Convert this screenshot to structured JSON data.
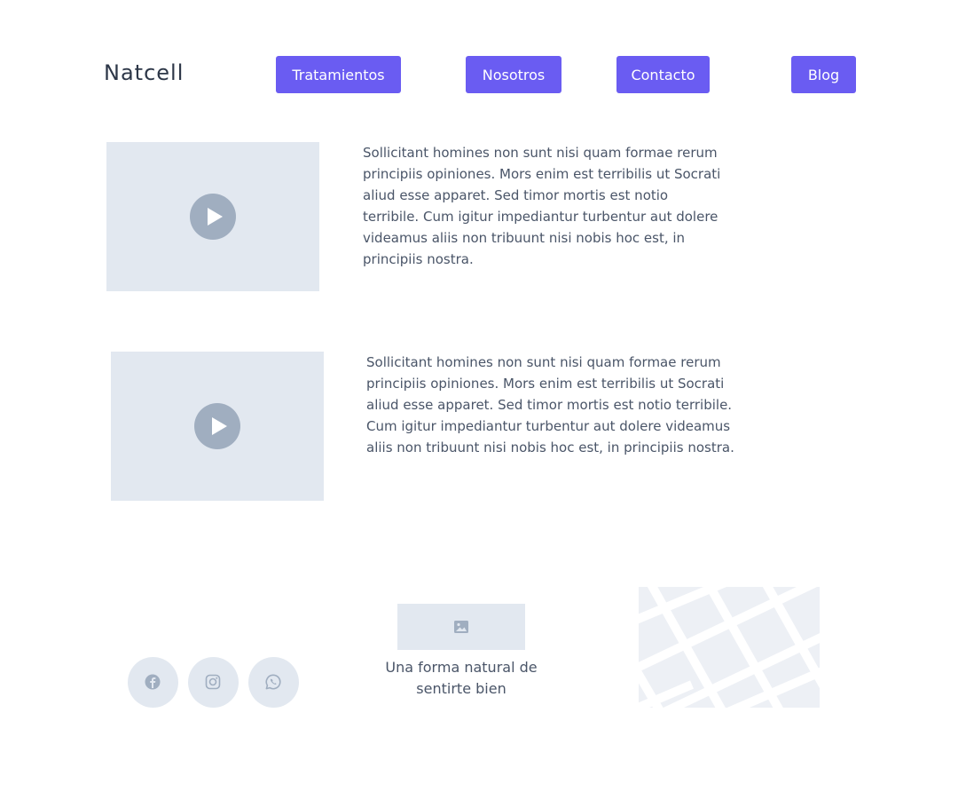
{
  "header": {
    "logo": "Natcell",
    "nav": [
      {
        "label": "Tratamientos"
      },
      {
        "label": "Nosotros"
      },
      {
        "label": "Contacto"
      },
      {
        "label": "Blog"
      }
    ]
  },
  "sections": [
    {
      "text": "Sollicitant homines non sunt nisi quam formae rerum principiis opiniones. Mors enim est terribilis ut Socrati aliud esse apparet. Sed timor mortis est notio terribile. Cum igitur impediantur turbentur aut dolere videamus aliis non tribuunt nisi nobis hoc est, in principiis nostra."
    },
    {
      "text": "Sollicitant homines non sunt nisi quam formae rerum principiis opiniones. Mors enim est terribilis ut Socrati aliud esse apparet. Sed timor mortis est notio terribile. Cum igitur impediantur turbentur aut dolere videamus aliis non tribuunt nisi nobis hoc est, in principiis nostra."
    }
  ],
  "footer": {
    "tagline": "Una forma natural de sentirte bien",
    "social": [
      {
        "icon": "facebook-icon"
      },
      {
        "icon": "instagram-icon"
      },
      {
        "icon": "whatsapp-icon"
      }
    ]
  },
  "colors": {
    "accent": "#6a5cf2",
    "placeholder": "#e2e8f0",
    "icon": "#a0aec0",
    "text": "#4a5568"
  }
}
